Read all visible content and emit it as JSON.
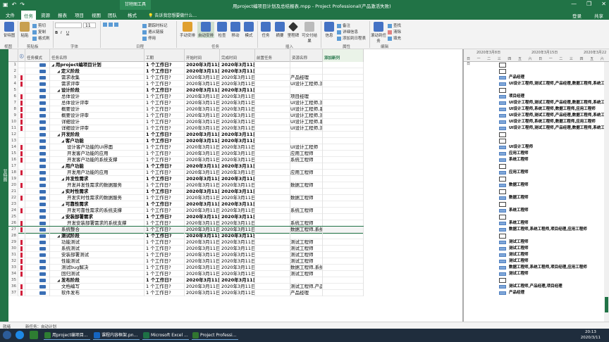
{
  "window": {
    "title": "用project编项目计划及总结报表.mpp - Project Professional(产品激活失败)",
    "context_tab": "甘特图工具",
    "controls": [
      "—",
      "❐",
      "✕"
    ]
  },
  "tabs": {
    "items": [
      {
        "label": "文件",
        "active": false
      },
      {
        "label": "任务",
        "active": true
      },
      {
        "label": "资源",
        "active": false
      },
      {
        "label": "报表",
        "active": false
      },
      {
        "label": "项目",
        "active": false
      },
      {
        "label": "视图",
        "active": false
      },
      {
        "label": "团队",
        "active": false
      },
      {
        "label": "格式",
        "active": false
      }
    ],
    "tell_me": "告诉我您想要做什么...",
    "login": "登录",
    "share": "共享"
  },
  "ribbon": {
    "groups": [
      {
        "label": "视图"
      },
      {
        "label": "剪贴板"
      },
      {
        "label": "字体"
      },
      {
        "label": "日程"
      },
      {
        "label": "任务"
      },
      {
        "label": "插入"
      },
      {
        "label": "属性"
      },
      {
        "label": "编辑"
      }
    ],
    "buttons": {
      "gantt": "甘特图",
      "paste": "粘贴",
      "cut": "剪切",
      "copy": "复制",
      "format_painter": "格式刷",
      "font_size": "11",
      "respect_links": "跟踪时标记",
      "respect_links2": "遵从链接",
      "inactivate": "停用",
      "manual_schedule": "手动安排",
      "auto_schedule": "自动安排",
      "inspect": "检查",
      "move": "移动",
      "mode": "模式",
      "task": "任务",
      "summary": "摘要",
      "milestone": "里程碑",
      "deliverable": "可交付结果",
      "info": "信息",
      "notes": "备注",
      "details": "详细信息",
      "add_timeline": "添加到日程表",
      "scroll_to_task": "滚动到任务",
      "find": "查找",
      "clear": "清除",
      "fill": "填充"
    }
  },
  "sidebar": {
    "label": "甘特图"
  },
  "columns": [
    "任务模式",
    "任务名称",
    "工期",
    "开始时间",
    "完成时间",
    "前置任务",
    "资源名称",
    "添加新列"
  ],
  "rows": [
    {
      "id": "1",
      "flag": false,
      "name": "用project编项目计划",
      "level": 0,
      "summary": true,
      "duration": "1 个工作日?",
      "start": "2020年3月11日",
      "finish": "2020年3月11日",
      "resource": ""
    },
    {
      "id": "2",
      "flag": false,
      "name": "定义阶段",
      "level": 1,
      "summary": true,
      "duration": "1 个工作日?",
      "start": "2020年3月11日",
      "finish": "2020年3月11日",
      "resource": ""
    },
    {
      "id": "3",
      "flag": true,
      "name": "需求收集",
      "level": 2,
      "summary": false,
      "duration": "1 个工作日?",
      "start": "2020年3月11日",
      "finish": "2020年3月11日",
      "resource": "产品经理"
    },
    {
      "id": "4",
      "flag": true,
      "name": "需求评审",
      "level": 2,
      "summary": false,
      "duration": "1 个工作日?",
      "start": "2020年3月11日",
      "finish": "2020年3月11日",
      "resource": "UI设计工程师,测"
    },
    {
      "id": "5",
      "flag": false,
      "name": "设计阶段",
      "level": 1,
      "summary": true,
      "duration": "1 个工作日?",
      "start": "2020年3月11日",
      "finish": "2020年3月11日",
      "resource": ""
    },
    {
      "id": "6",
      "flag": true,
      "name": "总体设计",
      "level": 2,
      "summary": false,
      "duration": "1 个工作日?",
      "start": "2020年3月11日",
      "finish": "2020年3月11日",
      "resource": "项目经理"
    },
    {
      "id": "7",
      "flag": true,
      "name": "总体设计评审",
      "level": 2,
      "summary": false,
      "duration": "1 个工作日?",
      "start": "2020年3月11日",
      "finish": "2020年3月11日",
      "resource": "UI设计工程师,测"
    },
    {
      "id": "8",
      "flag": true,
      "name": "概要设计",
      "level": 2,
      "summary": false,
      "duration": "1 个工作日?",
      "start": "2020年3月11日",
      "finish": "2020年3月11日",
      "resource": "UI设计工程师,系"
    },
    {
      "id": "9",
      "flag": true,
      "name": "概要设计评审",
      "level": 2,
      "summary": false,
      "duration": "1 个工作日?",
      "start": "2020年3月11日",
      "finish": "2020年3月11日",
      "resource": "UI设计工程师,测"
    },
    {
      "id": "10",
      "flag": true,
      "name": "详细设计",
      "level": 2,
      "summary": false,
      "duration": "1 个工作日?",
      "start": "2020年3月11日",
      "finish": "2020年3月11日",
      "resource": "UI设计工程师,系"
    },
    {
      "id": "11",
      "flag": true,
      "name": "详细设计评审",
      "level": 2,
      "summary": false,
      "duration": "1 个工作日?",
      "start": "2020年3月11日",
      "finish": "2020年3月11日",
      "resource": "UI设计工程师,测"
    },
    {
      "id": "12",
      "flag": false,
      "name": "开发阶段",
      "level": 1,
      "summary": true,
      "duration": "1 个工作日?",
      "start": "2020年3月11日",
      "finish": "2020年3月11日",
      "resource": ""
    },
    {
      "id": "13",
      "flag": false,
      "name": "客户功能",
      "level": 2,
      "summary": true,
      "duration": "1 个工作日?",
      "start": "2020年3月11日",
      "finish": "2020年3月11日",
      "resource": ""
    },
    {
      "id": "14",
      "flag": true,
      "name": "设计客户功能的UI界面",
      "level": 3,
      "summary": false,
      "duration": "1 个工作日?",
      "start": "2020年3月11日",
      "finish": "2020年3月11日",
      "resource": "UI设计工程师"
    },
    {
      "id": "15",
      "flag": true,
      "name": "开发客户功能的应用",
      "level": 3,
      "summary": false,
      "duration": "1 个工作日?",
      "start": "2020年3月11日",
      "finish": "2020年3月11日",
      "resource": "应用工程师"
    },
    {
      "id": "16",
      "flag": true,
      "name": "开发客户功能的系统支撑",
      "level": 3,
      "summary": false,
      "duration": "1 个工作日?",
      "start": "2020年3月11日",
      "finish": "2020年3月11日",
      "resource": "系统工程师"
    },
    {
      "id": "17",
      "flag": false,
      "name": "用户功能",
      "level": 2,
      "summary": true,
      "duration": "1 个工作日?",
      "start": "2020年3月11日",
      "finish": "2020年3月11日",
      "resource": ""
    },
    {
      "id": "18",
      "flag": true,
      "name": "开发用户功能的应用",
      "level": 3,
      "summary": false,
      "duration": "1 个工作日?",
      "start": "2020年3月11日",
      "finish": "2020年3月11日",
      "resource": "应用工程师"
    },
    {
      "id": "19",
      "flag": false,
      "name": "并发性需求",
      "level": 2,
      "summary": true,
      "duration": "1 个工作日?",
      "start": "2020年3月11日",
      "finish": "2020年3月11日",
      "resource": ""
    },
    {
      "id": "20",
      "flag": true,
      "name": "开发并发性需求的数据服务",
      "level": 3,
      "summary": false,
      "duration": "1 个工作日?",
      "start": "2020年3月11日",
      "finish": "2020年3月11日",
      "resource": "数据工程师"
    },
    {
      "id": "21",
      "flag": false,
      "name": "实时性需求",
      "level": 2,
      "summary": true,
      "duration": "1 个工作日?",
      "start": "2020年3月11日",
      "finish": "2020年3月11日",
      "resource": ""
    },
    {
      "id": "22",
      "flag": true,
      "name": "开发实时性需求的数据服务",
      "level": 3,
      "summary": false,
      "duration": "1 个工作日?",
      "start": "2020年3月11日",
      "finish": "2020年3月11日",
      "resource": "数据工程师"
    },
    {
      "id": "23",
      "flag": false,
      "name": "可靠性需求",
      "level": 2,
      "summary": true,
      "duration": "1 个工作日?",
      "start": "2020年3月11日",
      "finish": "2020年3月11日",
      "resource": ""
    },
    {
      "id": "24",
      "flag": true,
      "name": "开发可靠性需求的系统支撑",
      "level": 3,
      "summary": false,
      "duration": "1 个工作日?",
      "start": "2020年3月11日",
      "finish": "2020年3月11日",
      "resource": "系统工程师"
    },
    {
      "id": "25",
      "flag": false,
      "name": "安装部署需求",
      "level": 2,
      "summary": true,
      "duration": "1 个工作日?",
      "start": "2020年3月11日",
      "finish": "2020年3月11日",
      "resource": ""
    },
    {
      "id": "26",
      "flag": true,
      "name": "开发安装部署需求的系统支撑",
      "level": 3,
      "summary": false,
      "duration": "1 个工作日?",
      "start": "2020年3月11日",
      "finish": "2020年3月11日",
      "resource": "系统工程师"
    },
    {
      "id": "27",
      "flag": true,
      "name": "系统整合",
      "level": 2,
      "summary": false,
      "duration": "1 个工作日?",
      "start": "2020年3月11日",
      "finish": "2020年3月11日",
      "resource": "数据工程师,系统",
      "selected": true
    },
    {
      "id": "28",
      "flag": false,
      "name": "测试阶段",
      "level": 1,
      "summary": true,
      "duration": "1 个工作日?",
      "start": "2020年3月11日",
      "finish": "2020年3月11日",
      "resource": ""
    },
    {
      "id": "29",
      "flag": true,
      "name": "功能测试",
      "level": 2,
      "summary": false,
      "duration": "1 个工作日?",
      "start": "2020年3月11日",
      "finish": "2020年3月11日",
      "resource": "测试工程师"
    },
    {
      "id": "30",
      "flag": true,
      "name": "系统测试",
      "level": 2,
      "summary": false,
      "duration": "1 个工作日?",
      "start": "2020年3月11日",
      "finish": "2020年3月11日",
      "resource": "测试工程师"
    },
    {
      "id": "31",
      "flag": true,
      "name": "安装部署测试",
      "level": 2,
      "summary": false,
      "duration": "1 个工作日?",
      "start": "2020年3月11日",
      "finish": "2020年3月11日",
      "resource": "测试工程师"
    },
    {
      "id": "32",
      "flag": true,
      "name": "性能测试",
      "level": 2,
      "summary": false,
      "duration": "1 个工作日?",
      "start": "2020年3月11日",
      "finish": "2020年3月11日",
      "resource": "测试工程师"
    },
    {
      "id": "33",
      "flag": true,
      "name": "测试bug解决",
      "level": 2,
      "summary": false,
      "duration": "1 个工作日?",
      "start": "2020年3月11日",
      "finish": "2020年3月11日",
      "resource": "数据工程师,系统"
    },
    {
      "id": "34",
      "flag": true,
      "name": "回归测试",
      "level": 2,
      "summary": false,
      "duration": "1 个工作日?",
      "start": "2020年3月11日",
      "finish": "2020年3月11日",
      "resource": "测试工程师"
    },
    {
      "id": "35",
      "flag": false,
      "name": "发布阶段",
      "level": 1,
      "summary": true,
      "duration": "1 个工作日?",
      "start": "2020年3月11日",
      "finish": "2020年3月11日",
      "resource": ""
    },
    {
      "id": "36",
      "flag": true,
      "name": "文档编写",
      "level": 2,
      "summary": false,
      "duration": "1 个工作日?",
      "start": "2020年3月11日",
      "finish": "2020年3月11日",
      "resource": "测试工程师,产品"
    },
    {
      "id": "37",
      "flag": true,
      "name": "软件发布",
      "level": 2,
      "summary": false,
      "duration": "1 个工作日?",
      "start": "2020年3月11日",
      "finish": "2020年3月11日",
      "resource": "产品经理"
    }
  ],
  "gantt": {
    "header_weeks": [
      "2020年3月8日",
      "2020年3月15日",
      "2020年3月22"
    ],
    "header_days": "日 一 二 三 四 五 六 日 一 二 三 四 五 六 日",
    "labels": [
      "",
      "",
      "产品经理",
      "UI设计工程师,测试工程师,产品经理,数据工程师,系统工",
      "",
      "项目经理",
      "UI设计工程师,测试工程师,产品经理,数据工程师,系统工",
      "UI设计工程师,系统工程师,数据工程师,应用工程师",
      "UI设计工程师,测试工程师,产品经理,数据工程师,系统工",
      "UI设计工程师,系统工程师,数据工程师,应用工程师",
      "UI设计工程师,测试工程师,产品经理,数据工程师,系统工",
      "",
      "",
      "UI设计工程师",
      "应用工程师",
      "系统工程师",
      "",
      "应用工程师",
      "",
      "数据工程师",
      "",
      "数据工程师",
      "",
      "系统工程师",
      "",
      "系统工程师",
      "数据工程师,系统工程师,项目经理,应用工程师",
      "",
      "测试工程师",
      "测试工程师",
      "测试工程师",
      "测试工程师",
      "数据工程师,系统工程师,项目经理,应用工程师",
      "测试工程师",
      "",
      "测试工程师,产品经理,项目经理",
      "产品经理"
    ]
  },
  "status_bar": {
    "ready": "就绪",
    "new_tasks": "新任务：自动计划"
  },
  "taskbar": {
    "items": [
      {
        "label": "用project编项目...",
        "color": "#2e7d32"
      },
      {
        "label": "课程内容框架.pn...",
        "color": "#1565c0"
      },
      {
        "label": "Microsoft Excel ...",
        "color": "#1e7145"
      },
      {
        "label": "Project Professi...",
        "color": "#31752f"
      }
    ],
    "time": "20:13",
    "date": "2020/3/11"
  },
  "colors": {
    "accent": "#217346",
    "flag": "#d21f3c",
    "bar": "#7fa7d9"
  }
}
